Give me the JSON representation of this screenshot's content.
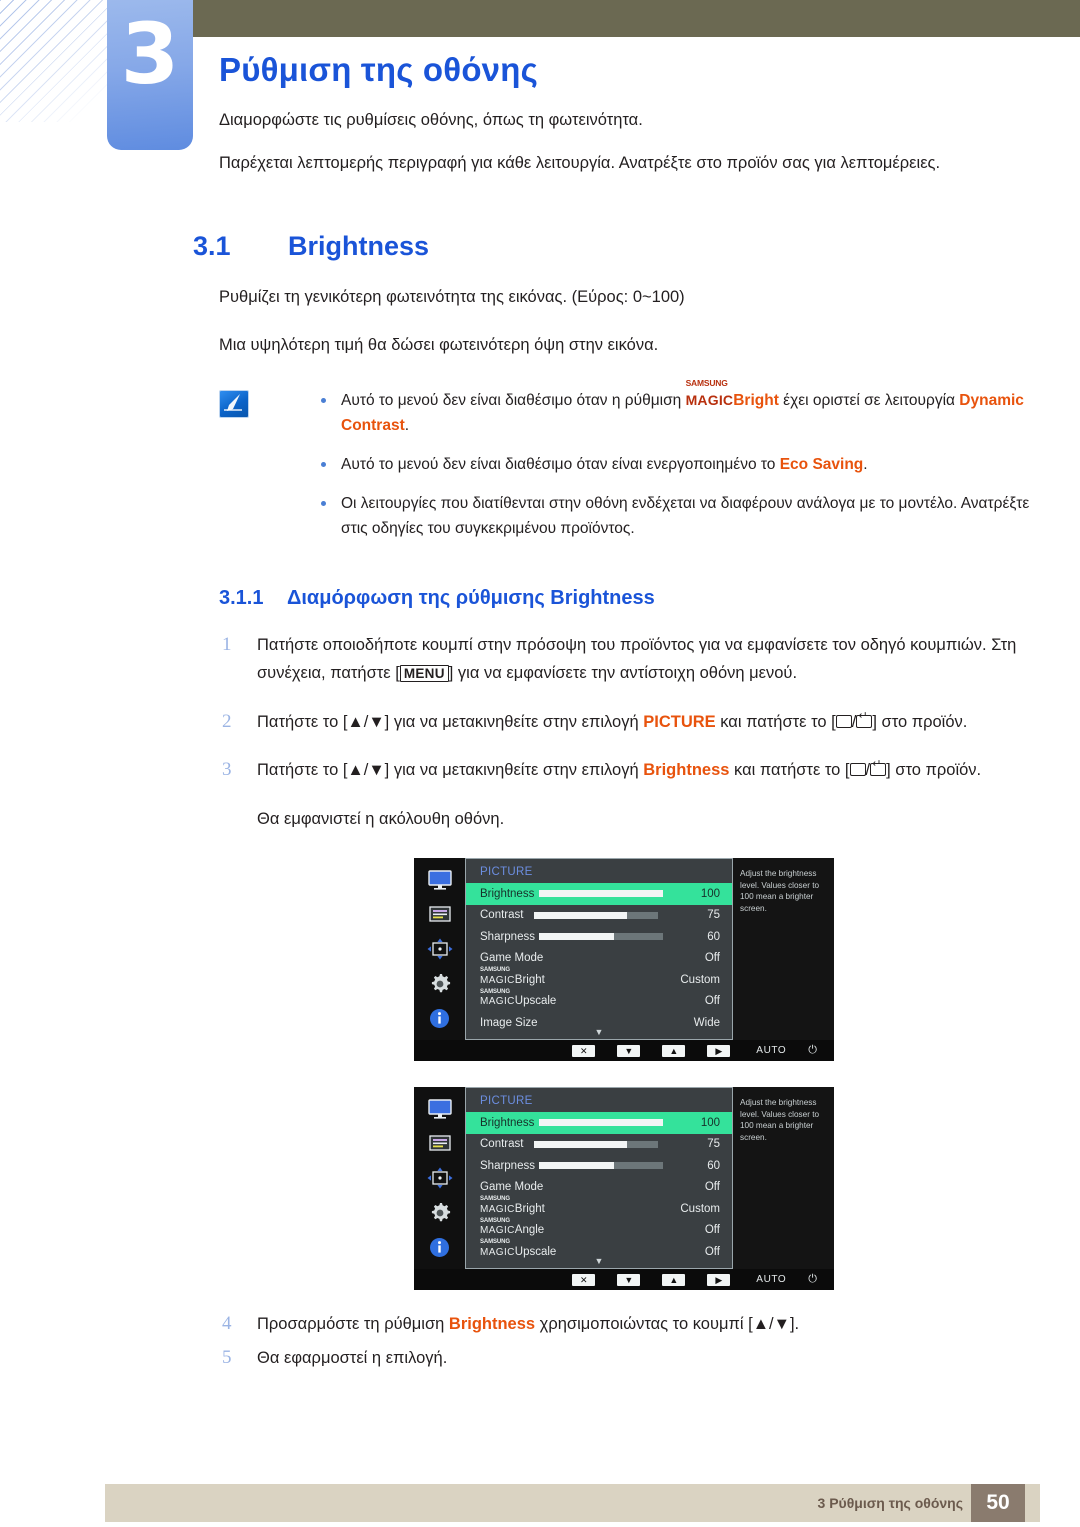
{
  "chapter": {
    "number": "3",
    "title": "Ρύθμιση της οθόνης",
    "intro_1": "Διαμορφώστε τις ρυθμίσεις οθόνης, όπως τη φωτεινότητα.",
    "intro_2": "Παρέχεται λεπτομερής περιγραφή για κάθε λειτουργία. Ανατρέξτε στο προϊόν σας για λεπτομέρειες."
  },
  "section": {
    "number": "3.1",
    "title": "Brightness",
    "para_1": "Ρυθμίζει τη γενικότερη φωτεινότητα της εικόνας. (Εύρος: 0~100)",
    "para_2": "Μια υψηλότερη τιμή θα δώσει φωτεινότερη όψη στην εικόνα."
  },
  "note": {
    "icon": "note-pencil-icon",
    "bullet_1_a": "Αυτό το μενού δεν είναι διαθέσιμο όταν η ρύθμιση ",
    "bullet_1_magic_top": "SAMSUNG",
    "bullet_1_magic_main": "MAGIC",
    "bullet_1_magic_suffix": "Bright",
    "bullet_1_b": " έχει οριστεί σε λειτουργία ",
    "bullet_1_hi": "Dynamic Contrast",
    "bullet_1_c": ".",
    "bullet_2_a": "Αυτό το μενού δεν είναι διαθέσιμο όταν είναι ενεργοποιημένο το ",
    "bullet_2_hi": "Eco Saving",
    "bullet_2_b": ".",
    "bullet_3": "Οι λειτουργίες που διατίθενται στην οθόνη ενδέχεται να διαφέρουν ανάλογα με το μοντέλο. Ανατρέξτε στις οδηγίες του συγκεκριμένου προϊόντος."
  },
  "subsection": {
    "number": "3.1.1",
    "title": "Διαμόρφωση της ρύθμισης Brightness"
  },
  "steps": [
    {
      "num": "1",
      "text_a": "Πατήστε οποιοδήποτε κουμπί στην πρόσοψη του προϊόντος για να εμφανίσετε τον οδηγό κουμπιών. Στη συνέχεια, πατήστε [",
      "key": "MENU",
      "text_b": "] για να εμφανίσετε την αντίστοιχη οθόνη μενού."
    },
    {
      "num": "2",
      "text_a": "Πατήστε το [▲/▼] για να μετακινηθείτε στην επιλογή ",
      "hi": "PICTURE",
      "text_b": " και πατήστε το [",
      "text_c": "] στο προϊόν."
    },
    {
      "num": "3",
      "text_a": "Πατήστε το [▲/▼] για να μετακινηθείτε στην επιλογή ",
      "hi": "Brightness",
      "text_b": " και πατήστε το [",
      "text_c": "] στο προϊόν.",
      "sub_note": "Θα εμφανιστεί η ακόλουθη οθόνη."
    },
    {
      "num": "4",
      "text_a": "Προσαρμόστε τη ρύθμιση ",
      "hi": "Brightness",
      "text_b": " χρησιμοποιώντας το κουμπί [▲/▼]."
    },
    {
      "num": "5",
      "text_a": "Θα εφαρμοστεί η επιλογή."
    }
  ],
  "osd_common": {
    "menu_title": "PICTURE",
    "help_text": "Adjust the brightness level. Values closer to 100 mean a brighter screen.",
    "rail_icons": [
      "monitor-icon",
      "osd-list-icon",
      "position-arrows-icon",
      "gear-icon",
      "info-icon"
    ],
    "footer_buttons": [
      "close-icon",
      "down-arrow-icon",
      "up-arrow-icon",
      "right-arrow-icon"
    ],
    "auto_label": "AUTO",
    "power_label": "power-icon",
    "scroll_caret": "▼",
    "highlight_color": "#34e29b",
    "title_color": "#6c8ee0"
  },
  "osd_first": [
    {
      "label": "Brightness",
      "value": "100",
      "bar": 100,
      "selected": true
    },
    {
      "label": "Contrast",
      "value": "75",
      "bar": 75,
      "selected": false
    },
    {
      "label": "Sharpness",
      "value": "60",
      "bar": 60,
      "selected": false
    },
    {
      "label": "Game Mode",
      "value": "Off",
      "bar": null,
      "selected": false
    },
    {
      "label": "MAGICBright",
      "magic": true,
      "magic_top": "SAMSUNG",
      "magic_main": "MAGIC",
      "magic_suffix": "Bright",
      "value": "Custom",
      "bar": null,
      "selected": false
    },
    {
      "label": "MAGICUpscale",
      "magic": true,
      "magic_top": "SAMSUNG",
      "magic_main": "MAGIC",
      "magic_suffix": "Upscale",
      "value": "Off",
      "bar": null,
      "selected": false
    },
    {
      "label": "Image Size",
      "value": "Wide",
      "bar": null,
      "selected": false
    }
  ],
  "osd_second": [
    {
      "label": "Brightness",
      "value": "100",
      "bar": 100,
      "selected": true
    },
    {
      "label": "Contrast",
      "value": "75",
      "bar": 75,
      "selected": false
    },
    {
      "label": "Sharpness",
      "value": "60",
      "bar": 60,
      "selected": false
    },
    {
      "label": "Game Mode",
      "value": "Off",
      "bar": null,
      "selected": false
    },
    {
      "label": "MAGICBright",
      "magic": true,
      "magic_top": "SAMSUNG",
      "magic_main": "MAGIC",
      "magic_suffix": "Bright",
      "value": "Custom",
      "bar": null,
      "selected": false
    },
    {
      "label": "MAGICAngle",
      "magic": true,
      "magic_top": "SAMSUNG",
      "magic_main": "MAGIC",
      "magic_suffix": "Angle",
      "value": "Off",
      "bar": null,
      "selected": false
    },
    {
      "label": "MAGICUpscale",
      "magic": true,
      "magic_top": "SAMSUNG",
      "magic_main": "MAGIC",
      "magic_suffix": "Upscale",
      "value": "Off",
      "bar": null,
      "selected": false
    }
  ],
  "footer": {
    "text": "3 Ρύθμιση της οθόνης",
    "page": "50"
  }
}
